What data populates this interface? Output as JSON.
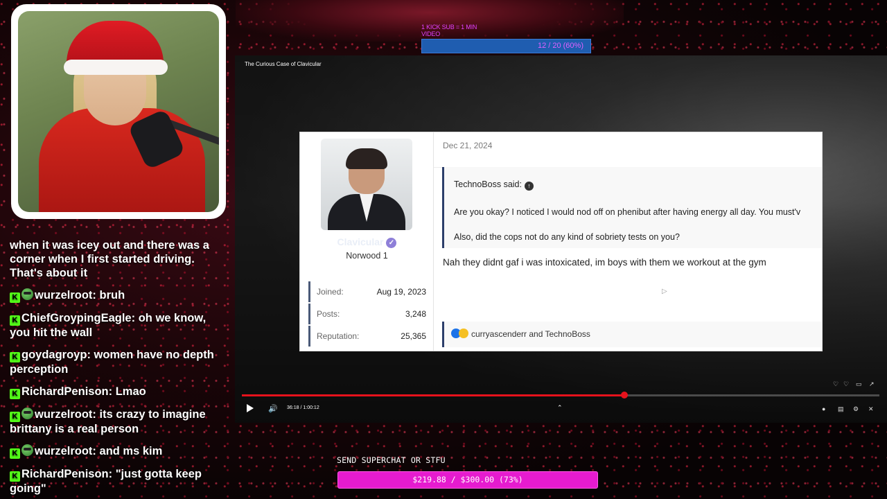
{
  "overlay": {
    "sub_goal_label": "1 KICK SUB = 1 MIN VIDEO",
    "sub_goal_progress": "12 / 20 (60%)",
    "sub_goal_fraction": 0.6,
    "superchat_label": "SEND SUPERCHAT OR STFU",
    "superchat_progress": "$219.88 / $300.00 (73%)",
    "superchat_fraction": 0.73
  },
  "chat": [
    {
      "badge": "none",
      "emote": false,
      "user": "",
      "message": "when it was icey out and there was a corner when I first started driving. That's about it"
    },
    {
      "badge": "kick",
      "emote": true,
      "user": "wurzelroot",
      "message": "bruh"
    },
    {
      "badge": "kick",
      "emote": false,
      "user": "ChiefGroypingEagle",
      "message": "oh we know, you hit the wall"
    },
    {
      "badge": "kick",
      "emote": false,
      "user": "goydagroyp",
      "message": "women have no depth perception"
    },
    {
      "badge": "kick",
      "emote": false,
      "user": "RichardPenison",
      "message": "Lmao"
    },
    {
      "badge": "kick",
      "emote": true,
      "user": "wurzelroot",
      "message": "its crazy to imagine brittany is a real person"
    },
    {
      "badge": "kick",
      "emote": true,
      "user": "wurzelroot",
      "message": "and ms kim"
    },
    {
      "badge": "kick",
      "emote": false,
      "user": "RichardPenison",
      "message": "\"just gotta keep going\""
    }
  ],
  "video": {
    "title": "The Curious Case of Clavicular",
    "time": "36:18 / 1:00:12",
    "progress_fraction": 0.6
  },
  "post": {
    "username": "Clavicular",
    "user_title": "Norwood 1",
    "stats": [
      {
        "label": "Joined:",
        "value": "Aug 19, 2023"
      },
      {
        "label": "Posts:",
        "value": "3,248"
      },
      {
        "label": "Reputation:",
        "value": "25,365"
      }
    ],
    "date": "Dec 21, 2024",
    "quote_author": "TechnoBoss said:",
    "quote_lines": [
      "Are you okay? I noticed I would nod off on phenibut after having energy all day. You must'v",
      "Also, did the cops not do any kind of sobriety tests on you?"
    ],
    "reply": "Nah they didnt gaf i was intoxicated, im boys with them we workout at the gym",
    "reactions": "curryascenderr and TechnoBoss"
  },
  "icons": {
    "kick_badge": "K",
    "quote_arrow": "↑",
    "verified": "✓",
    "volume": "🔊",
    "chevron_up": "⌃"
  },
  "colors": {
    "kick_green": "#53fc18",
    "progress_red": "#e6121c",
    "superchat_pink": "#e61bcf",
    "sub_goal_blue": "#1f5db0"
  }
}
